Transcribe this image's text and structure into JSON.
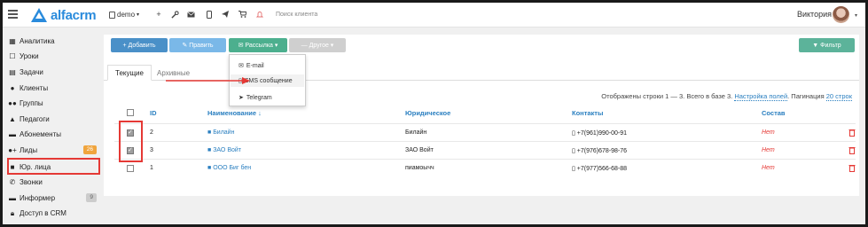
{
  "app": {
    "logo": "alfacrm"
  },
  "topbar": {
    "branch": "demo",
    "search_placeholder": "Поиск клиента",
    "user_name": "Виктория",
    "icons": [
      "plus-icon",
      "wrench-icon",
      "mail-icon",
      "phone-icon",
      "telegram-icon",
      "cart-icon",
      "bell-icon"
    ]
  },
  "sidebar": {
    "items": [
      {
        "label": "Аналитика",
        "icon": "analytics-icon"
      },
      {
        "label": "Уроки",
        "icon": "calendar-icon"
      },
      {
        "label": "Задачи",
        "icon": "tasks-icon"
      },
      {
        "label": "Клиенты",
        "icon": "user-icon"
      },
      {
        "label": "Группы",
        "icon": "group-icon"
      },
      {
        "label": "Педагоги",
        "icon": "graduation-icon"
      },
      {
        "label": "Абонементы",
        "icon": "card-icon"
      },
      {
        "label": "Лиды",
        "icon": "user-plus-icon",
        "badge": "26"
      },
      {
        "label": "Юр. лица",
        "icon": "briefcase-icon"
      },
      {
        "label": "Звонки",
        "icon": "phone-icon"
      },
      {
        "label": "Информер",
        "icon": "info-icon",
        "badge": "9"
      },
      {
        "label": "Доступ в CRM",
        "icon": "lock-icon"
      }
    ]
  },
  "toolbar": {
    "add": "+ Добавить",
    "edit": "✎ Править",
    "mailing": "✉ Рассылка ▾",
    "other": "— Другое ▾",
    "filter": "▼ Фильтр"
  },
  "mailing_menu": {
    "items": [
      {
        "label": "E-mail",
        "icon": "mail-icon"
      },
      {
        "label": "SMS сообщение",
        "icon": "phone-icon"
      },
      {
        "label": "Telegram",
        "icon": "telegram-icon"
      }
    ]
  },
  "tabs": {
    "current": "Текущие",
    "archived": "Архивные"
  },
  "table_info": {
    "shown": "Отображены строки 1 — 3. Всего в базе 3.",
    "settings": "Настройка полей",
    "pagination_label": ". Пагинация",
    "pagination_value": "20 строк"
  },
  "table": {
    "headers": {
      "id": "ID",
      "name": "Наименование ↓",
      "legal": "Юридическое",
      "contacts": "Контакты",
      "staff": "Состав"
    },
    "rows": [
      {
        "id": "2",
        "name": "Билайн",
        "legal": "Билайн",
        "phone": "+7(961)990-00-91",
        "staff": "Нет",
        "checked": true
      },
      {
        "id": "3",
        "name": "ЗАО Войт",
        "legal": "ЗАО Войт",
        "phone": "+7(976)678-98-76",
        "staff": "Нет",
        "checked": true
      },
      {
        "id": "1",
        "name": "ООО Биг бен",
        "legal": "пиамоычч",
        "phone": "+7(977)566-68-88",
        "staff": "Нет",
        "checked": false
      }
    ]
  },
  "colors": {
    "accent": "#2a7fc0",
    "highlight": "#e53935",
    "mailing_button": "#4caf8e"
  }
}
